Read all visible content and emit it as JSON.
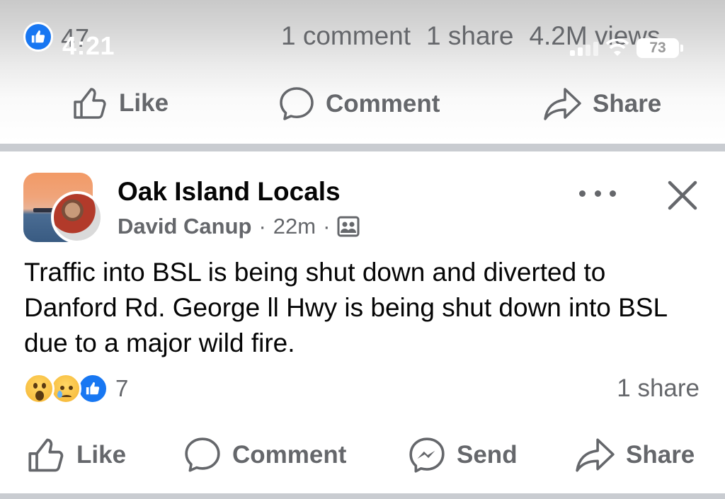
{
  "status_bar": {
    "time": "4:21",
    "battery": "73"
  },
  "prev_post": {
    "like_count": "47",
    "comments": "1 comment",
    "shares": "1 share",
    "views": "4.2M views",
    "actions": {
      "like": "Like",
      "comment": "Comment",
      "share": "Share"
    }
  },
  "post": {
    "group_name": "Oak Island Locals",
    "author": "David Canup",
    "time": "22m",
    "text": "Traffic into BSL is being shut down and diverted to Danford Rd. George ll Hwy is being shut down into BSL due to a major wild fire.",
    "reaction_count": "7",
    "share_count": "1 share",
    "actions": {
      "like": "Like",
      "comment": "Comment",
      "send": "Send",
      "share": "Share"
    }
  },
  "colors": {
    "accent": "#1877f2",
    "muted_text": "#65676b",
    "divider": "#c9ccd1"
  },
  "icons": [
    "like-icon",
    "comment-icon",
    "share-icon",
    "send-messenger-icon",
    "more-options-icon",
    "close-icon",
    "group-privacy-icon"
  ]
}
